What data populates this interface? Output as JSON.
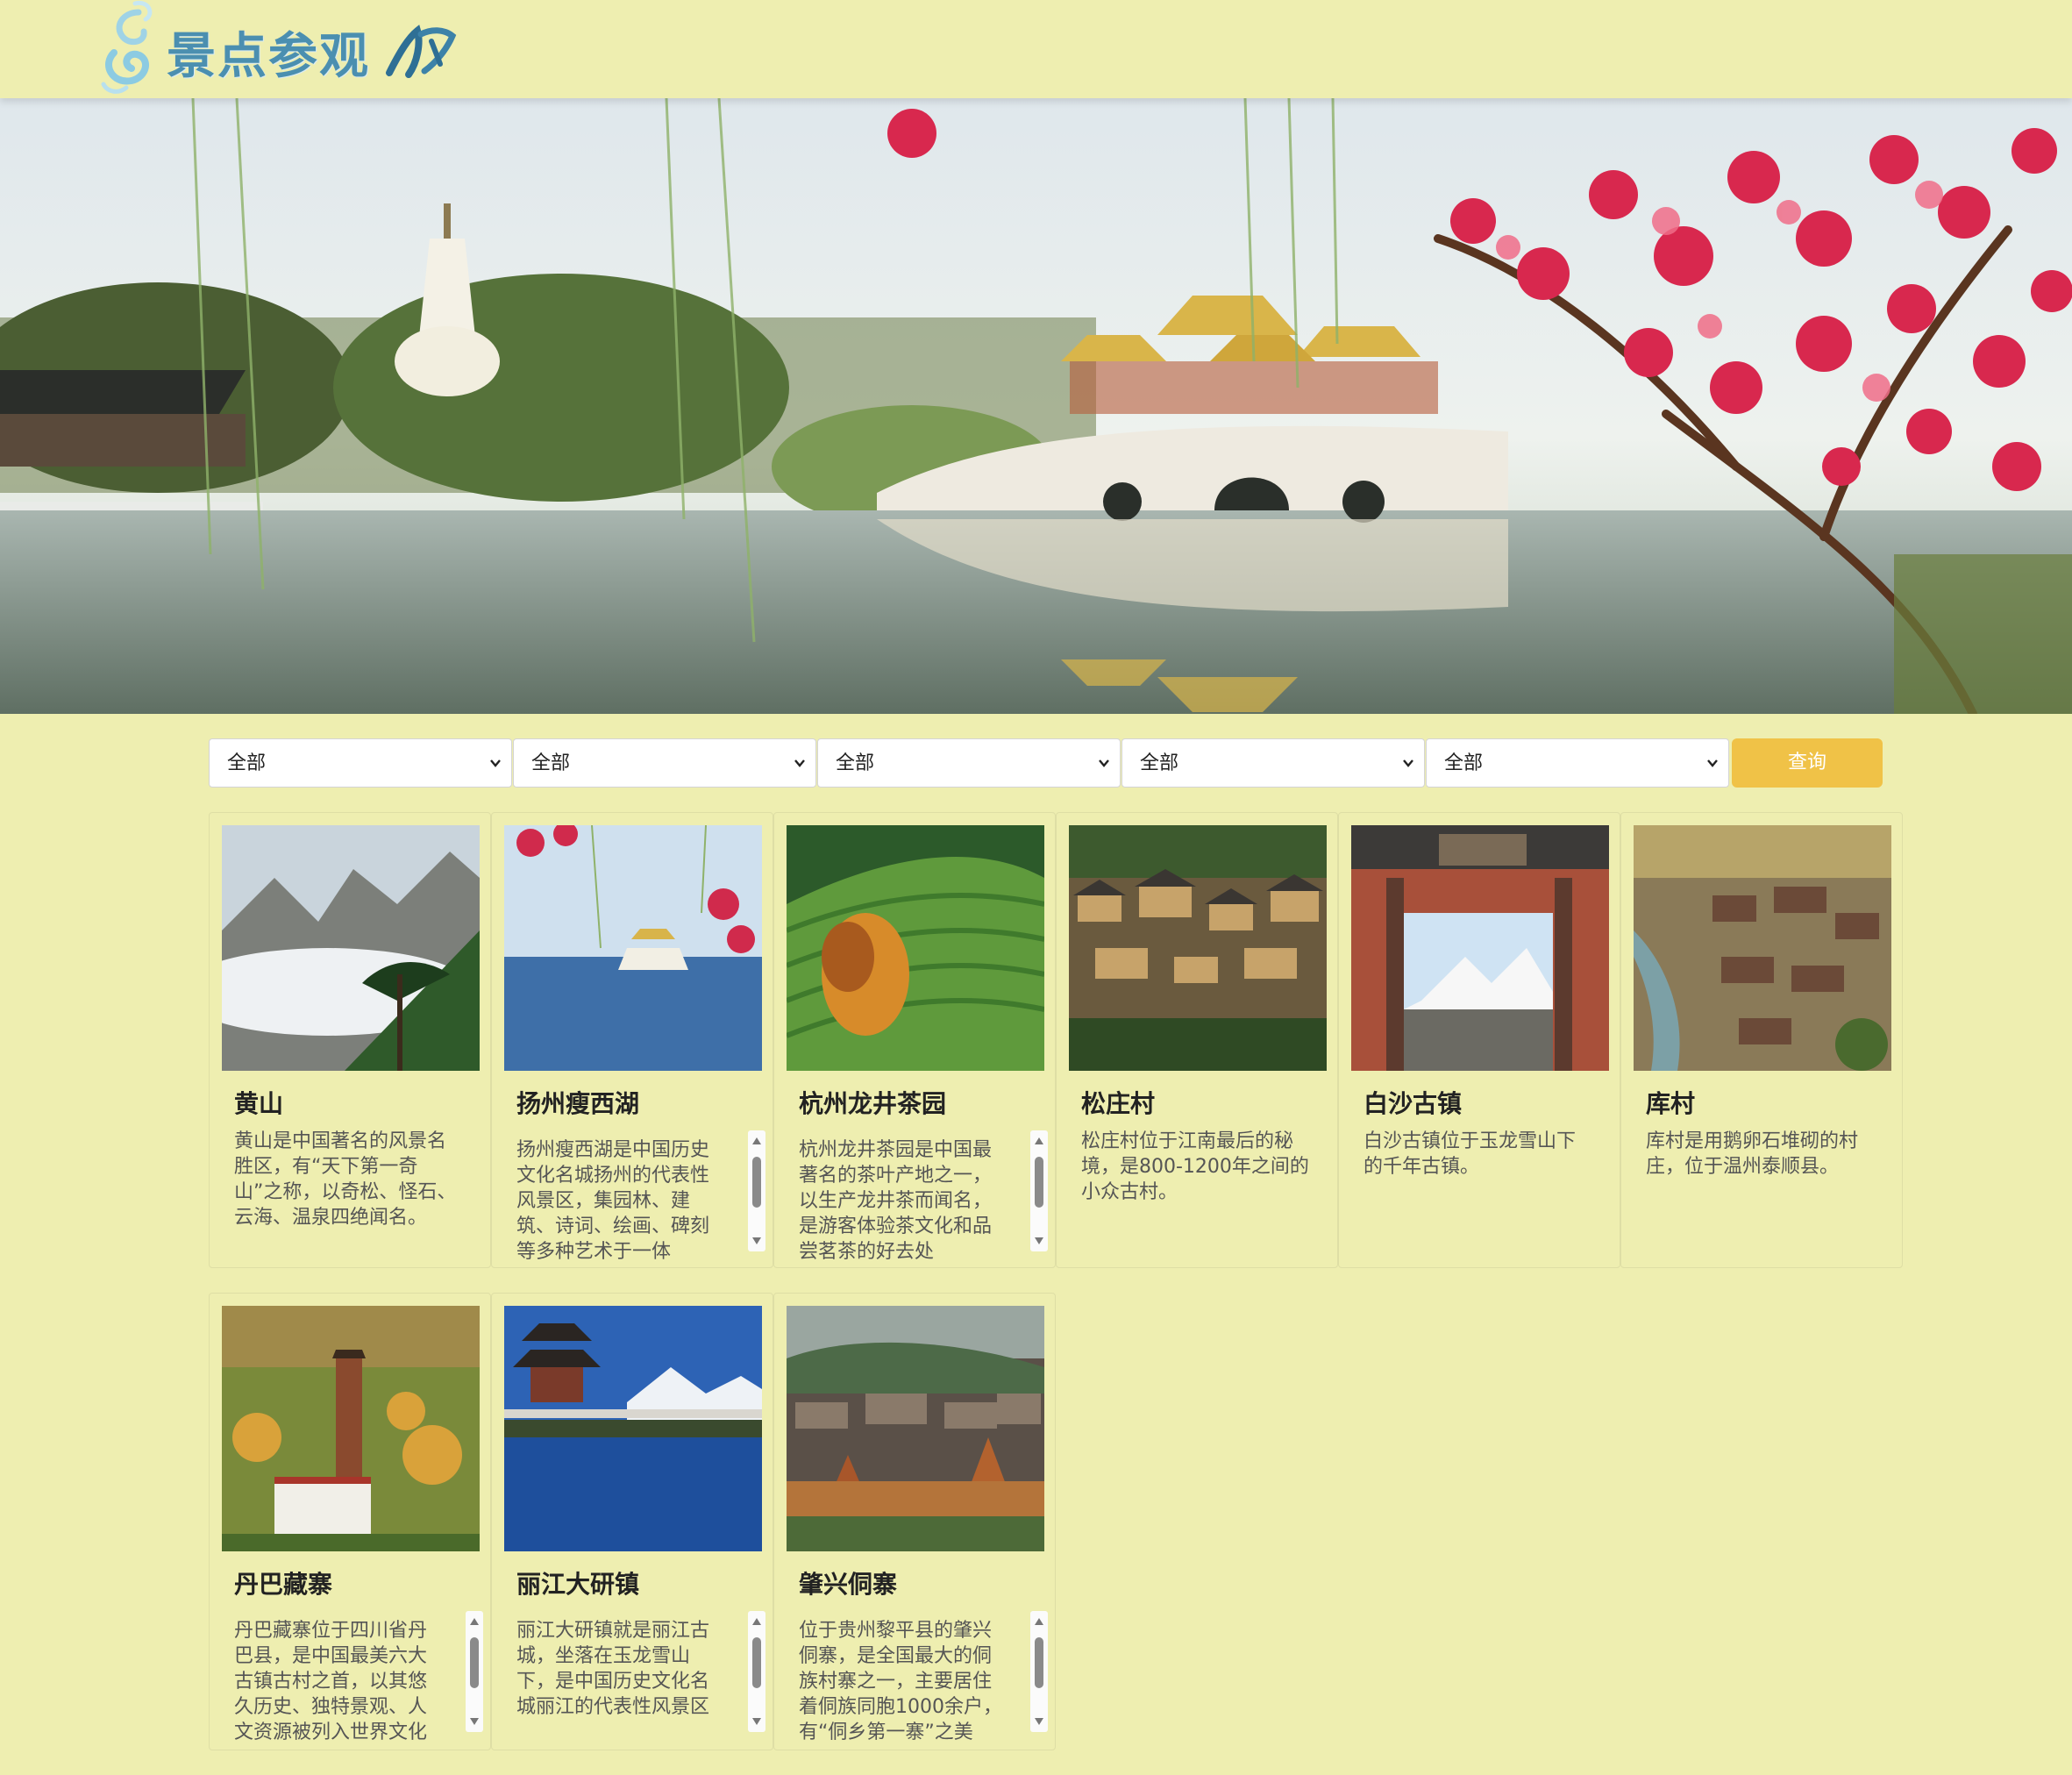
{
  "header": {
    "logo_text": "景点参观"
  },
  "filters": [
    {
      "selected": "全部"
    },
    {
      "selected": "全部"
    },
    {
      "selected": "全部"
    },
    {
      "selected": "全部"
    },
    {
      "selected": "全部"
    }
  ],
  "query_label": "查询",
  "attractions": [
    {
      "name": "黄山",
      "description": "黄山是中国著名的风景名胜区，有“天下第一奇山”之称，以奇松、怪石、云海、温泉四绝闻名。",
      "scrollable": false
    },
    {
      "name": "扬州瘦西湖",
      "description": "扬州瘦西湖是中国历史文化名城扬州的代表性风景区，集园林、建筑、诗词、绘画、碑刻等多种艺术于一体",
      "scrollable": true
    },
    {
      "name": "杭州龙井茶园",
      "description": "杭州龙井茶园是中国最著名的茶叶产地之一，以生产龙井茶而闻名，是游客体验茶文化和品尝茗茶的好去处",
      "scrollable": true
    },
    {
      "name": "松庄村",
      "description": "松庄村位于江南最后的秘境，是800-1200年之间的小众古村。",
      "scrollable": false
    },
    {
      "name": "白沙古镇",
      "description": "白沙古镇位于玉龙雪山下的千年古镇。",
      "scrollable": false
    },
    {
      "name": "库村",
      "description": "库村是用鹅卵石堆砌的村庄，位于温州泰顺县。",
      "scrollable": false
    },
    {
      "name": "丹巴藏寨",
      "description": "丹巴藏寨位于四川省丹巴县，是中国最美六大古镇古村之首，以其悠久历史、独特景观、人文资源被列入世界文化",
      "scrollable": true
    },
    {
      "name": "丽江大研镇",
      "description": "丽江大研镇就是丽江古城，坐落在玉龙雪山下，是中国历史文化名城丽江的代表性风景区",
      "scrollable": true
    },
    {
      "name": "肇兴侗寨",
      "description": "位于贵州黎平县的肇兴侗寨，是全国最大的侗族村寨之一，主要居住着侗族同胞1000余户，有“侗乡第一寨”之美",
      "scrollable": true
    }
  ]
}
